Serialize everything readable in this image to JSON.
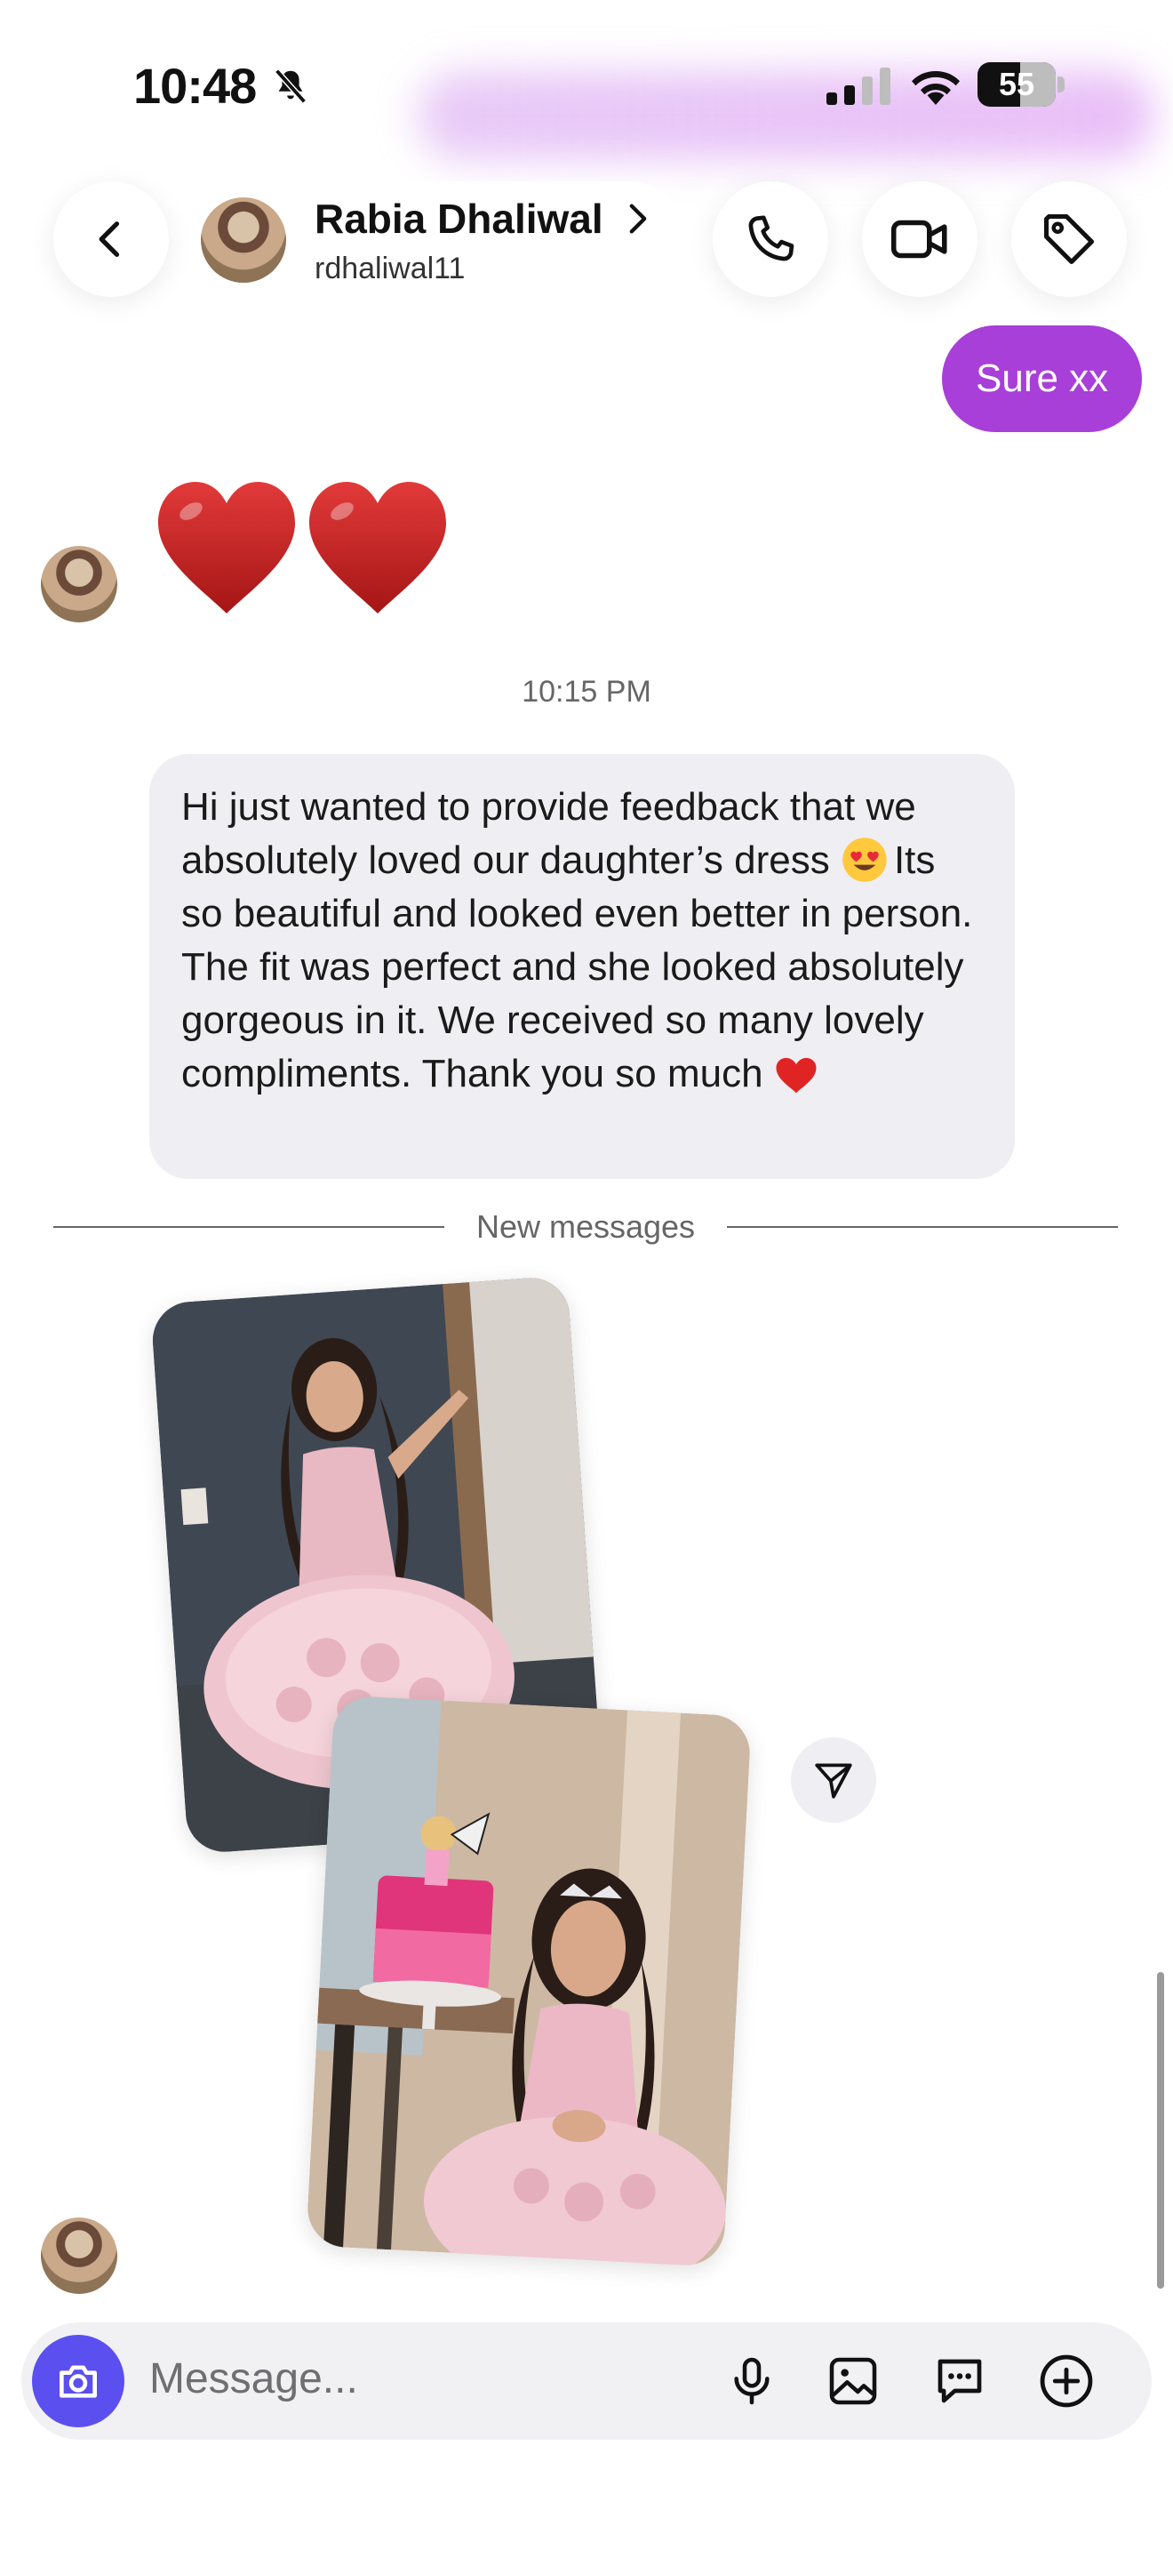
{
  "status_bar": {
    "time": "10:48",
    "battery": "55",
    "icons": [
      "bell-slash-icon",
      "cellular-signal-icon",
      "wifi-icon",
      "battery-icon"
    ]
  },
  "header": {
    "name": "Rabia Dhaliwal",
    "handle": "rdhaliwal11",
    "icons": [
      "back-chevron-icon",
      "phone-icon",
      "video-camera-icon",
      "tag-icon",
      "chevron-right-icon"
    ]
  },
  "messages": {
    "sent_text": "Sure xx",
    "hearts_reaction": "❤️❤️",
    "timestamp": "10:15 PM",
    "received_text_line1": "Hi just wanted to provide feedback that we absolutely loved our daughter’s dress",
    "received_text_line2": "Its so beautiful and looked even better in person. The fit was perfect and she looked absolutely gorgeous in it. We received so many lovely compliments. Thank you so much",
    "new_messages_label": "New messages"
  },
  "composer": {
    "placeholder": "Message...",
    "icons": [
      "camera-icon",
      "microphone-icon",
      "gallery-icon",
      "sticker-icon",
      "plus-circle-icon"
    ]
  },
  "colors": {
    "sent_bubble": "#a83fd8",
    "received_bubble": "#efeff3",
    "camera_button": "#5b4ff0"
  }
}
